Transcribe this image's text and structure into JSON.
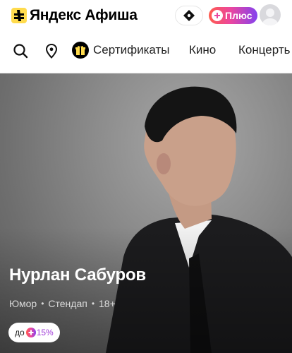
{
  "header": {
    "brand": "Яндекс Афиша",
    "plus_label": "Плюс",
    "icons": {
      "logo": "yandex-afisha-logo-icon",
      "ticket": "ticket-icon",
      "plus": "plus-icon",
      "avatar": "user-avatar"
    }
  },
  "nav": {
    "items": [
      {
        "label": "Сертификаты",
        "icon": "gift-icon"
      },
      {
        "label": "Кино"
      },
      {
        "label": "Концерть"
      }
    ],
    "icons": [
      "search-icon",
      "location-pin-icon"
    ]
  },
  "hero": {
    "title": "Нурлан Сабуров",
    "tags": [
      "Юмор",
      "Стендап",
      "18+"
    ],
    "discount": {
      "prefix": "до",
      "value": "15%"
    }
  },
  "colors": {
    "brand_yellow": "#ffdb4d",
    "plus_gradient": [
      "#ff5c4d",
      "#eb469f",
      "#8341ef"
    ],
    "discount_purple": "#a13dd8"
  }
}
